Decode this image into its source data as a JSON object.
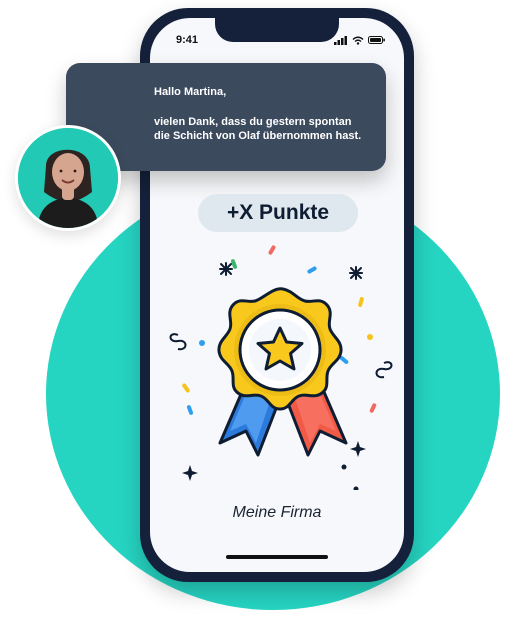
{
  "status_bar": {
    "time": "9:41"
  },
  "message": {
    "greeting": "Hallo Martina,",
    "body_lines": [
      "vielen Dank, dass du gestern spontan",
      "die Schicht von Olaf übernommen hast."
    ]
  },
  "points_label": "+X Punkte",
  "company_name": "Meine Firma",
  "icons": {
    "signal": "signal-icon",
    "wifi": "wifi-icon",
    "battery": "battery-icon",
    "badge": "award-badge-icon",
    "star": "star-icon"
  },
  "colors": {
    "accent_bg": "#26d4c2",
    "phone_frame": "#15213a",
    "message_bg": "#3c4a5e",
    "points_pill": "#dfe7ef"
  }
}
